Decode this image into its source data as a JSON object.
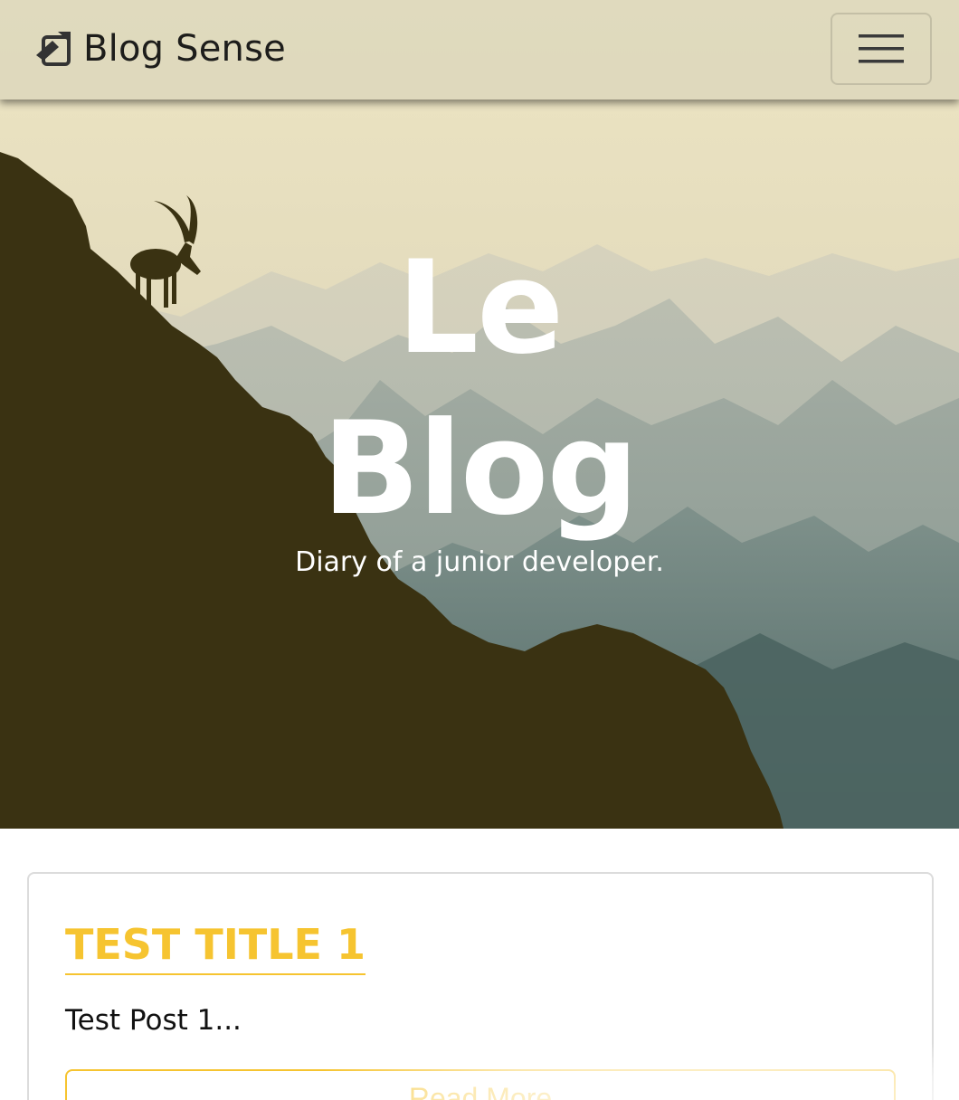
{
  "navbar": {
    "brand_text": "Blog Sense",
    "brand_icon": "note-pencil-icon",
    "toggler_icon": "hamburger-menu-icon"
  },
  "hero": {
    "title_line1": "Le",
    "title_line2": "Blog",
    "subtitle": "Diary of a junior developer."
  },
  "posts": [
    {
      "title": "TEST TITLE 1",
      "excerpt": "Test Post 1...",
      "button_label": "Read More"
    }
  ],
  "colors": {
    "accent": "#f6c430",
    "cliff": "#3a3212",
    "text_dark": "#1d1d1b"
  }
}
